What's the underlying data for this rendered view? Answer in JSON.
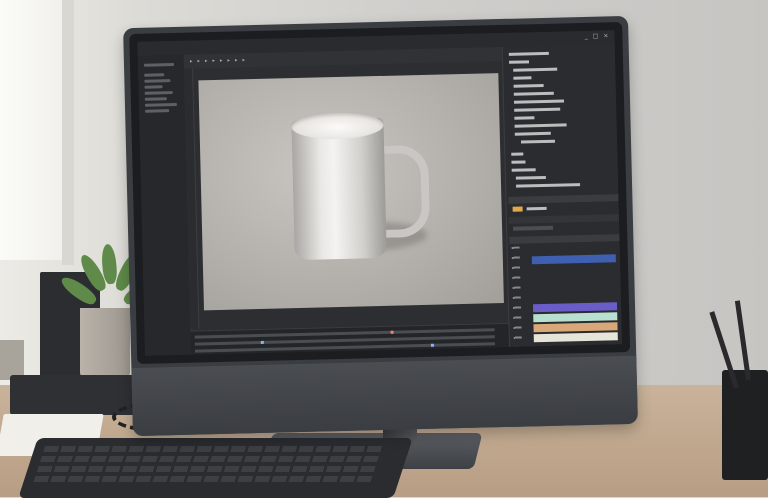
{
  "scene": {
    "description_free": true
  },
  "monitor": {
    "titlebar": {
      "controls": [
        "_",
        "□",
        "×"
      ]
    },
    "toolbar": {
      "items": [
        "▸",
        "▸",
        "▸",
        "▸",
        "▸",
        "▸",
        "▸",
        "▸"
      ]
    },
    "viewport": {
      "tab_label": ""
    },
    "properties_panel": {
      "lines": [
        "",
        "",
        "",
        "",
        "",
        "",
        "",
        "",
        "",
        "",
        "",
        "",
        "",
        "",
        "",
        "",
        ""
      ],
      "swatches": [
        "#3f5fb0",
        "#6b5dc7",
        "#b7e0d0",
        "#d8a878",
        "#e7e4d8"
      ]
    }
  },
  "colors": {
    "screen_bg": "#2c2e31",
    "viewport_bg": "#b7b4af",
    "accent": "#8ab2ff"
  },
  "icons": [
    "minimize-icon",
    "maximize-icon",
    "close-icon",
    "mug-icon"
  ]
}
